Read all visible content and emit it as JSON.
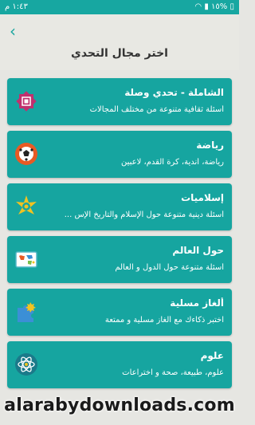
{
  "status_bar": {
    "time": "١:٤٣ م",
    "battery": "١٥%"
  },
  "header": {
    "back_icon": "chevron-left-icon",
    "title": "اختر مجال التحدي"
  },
  "categories": [
    {
      "title": "الشاملة - تحدي وصلة",
      "description": "أسئلة ثقافية متنوعة من مختلف المجالات",
      "icon": "islamic-star-icon",
      "icon_color": "#c0306e"
    },
    {
      "title": "رياضة",
      "description": "رياضة، أندية، كرة القدم، لاعبين",
      "icon": "soccer-ball-icon",
      "icon_color": "#e85a24"
    },
    {
      "title": "إسلاميات",
      "description": "أسئلة دينية متنوعة حول الإسلام والتاريخ الإس ...",
      "icon": "islamic-ornament-icon",
      "icon_color": "#f2c320"
    },
    {
      "title": "حول العالم",
      "description": "أسئلة متنوعة حول الدول و العالم",
      "icon": "world-map-icon",
      "icon_color": "#4fb6c6"
    },
    {
      "title": "ألغاز مسلية",
      "description": "اختبر ذكاءك مع ألغاز مسلية و ممتعة",
      "icon": "puzzle-icon",
      "icon_color": "#3b8fd6"
    },
    {
      "title": "علوم",
      "description": "علوم، طبيعة، صحة و اختراعات",
      "icon": "atom-icon",
      "icon_color": "#1b7a8a"
    }
  ],
  "watermark": "alarabydownloads.com"
}
